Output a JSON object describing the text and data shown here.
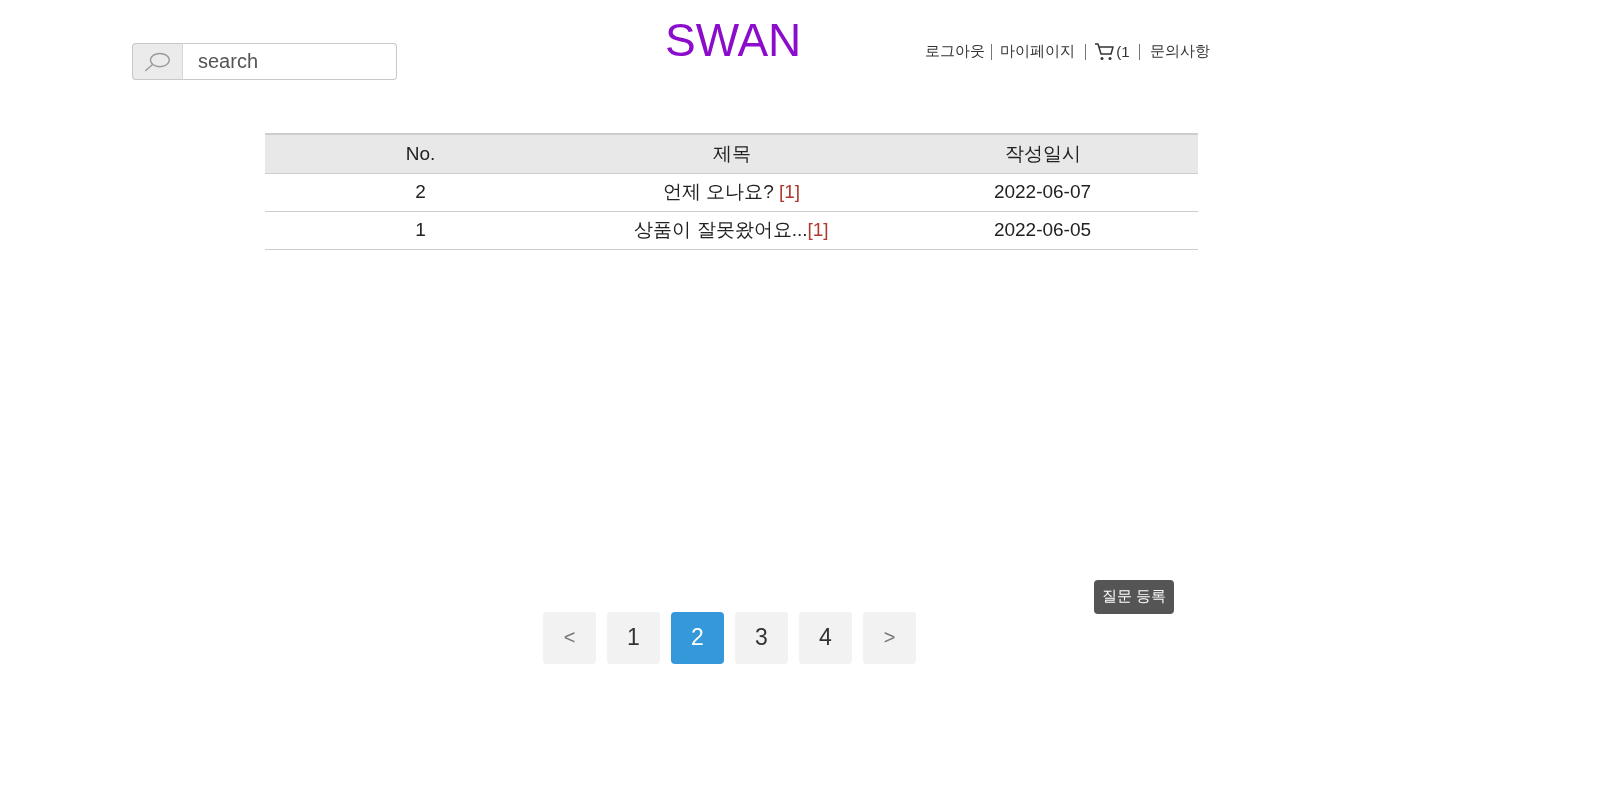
{
  "header": {
    "search": {
      "placeholder": "search"
    },
    "logo": "SWAN",
    "nav": [
      {
        "kind": "link",
        "label": "로그아웃"
      },
      {
        "kind": "link",
        "label": "마이페이지"
      },
      {
        "kind": "cart",
        "label": "(1"
      },
      {
        "kind": "link",
        "label": "문의사항"
      }
    ]
  },
  "table": {
    "columns": [
      "No.",
      "제목",
      "작성일시"
    ],
    "rows": [
      {
        "no": "2",
        "title": "언제 오나요? ",
        "comment_count": "[1]",
        "date": "2022-06-07"
      },
      {
        "no": "1",
        "title": "상품이 잘못왔어요...",
        "comment_count": "[1]",
        "date": "2022-06-05"
      }
    ]
  },
  "register_button": "질문 등록",
  "pagination": [
    {
      "kind": "prev",
      "label": "<",
      "selected": false
    },
    {
      "kind": "page",
      "label": "1",
      "selected": false
    },
    {
      "kind": "page",
      "label": "2",
      "selected": true
    },
    {
      "kind": "page",
      "label": "3",
      "selected": false
    },
    {
      "kind": "page",
      "label": "4",
      "selected": false
    },
    {
      "kind": "next",
      "label": ">",
      "selected": false
    }
  ]
}
